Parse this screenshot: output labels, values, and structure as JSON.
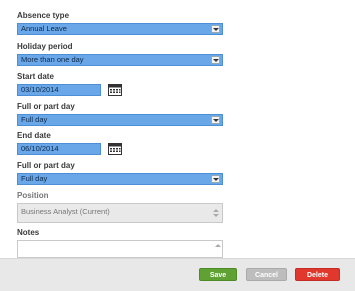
{
  "form": {
    "absence_type": {
      "label": "Absence type",
      "value": "Annual Leave"
    },
    "holiday_period": {
      "label": "Holiday period",
      "value": "More than one day"
    },
    "start_date": {
      "label": "Start date",
      "value": "03/10/2014"
    },
    "start_part_day": {
      "label": "Full or part day",
      "value": "Full day"
    },
    "end_date": {
      "label": "End date",
      "value": "06/10/2014"
    },
    "end_part_day": {
      "label": "Full or part day",
      "value": "Full day"
    },
    "position": {
      "label": "Position",
      "value": "Business Analyst (Current)"
    },
    "notes": {
      "label": "Notes",
      "value": ""
    }
  },
  "footer": {
    "save_label": "Save",
    "cancel_label": "Cancel",
    "delete_label": "Delete"
  },
  "colors": {
    "select_bg": "#6aa7e8",
    "save": "#5fa233",
    "cancel": "#bdbdbd",
    "delete": "#e0382d"
  },
  "icons": {
    "calendar": "calendar-icon",
    "dropdown": "chevron-down-icon"
  }
}
